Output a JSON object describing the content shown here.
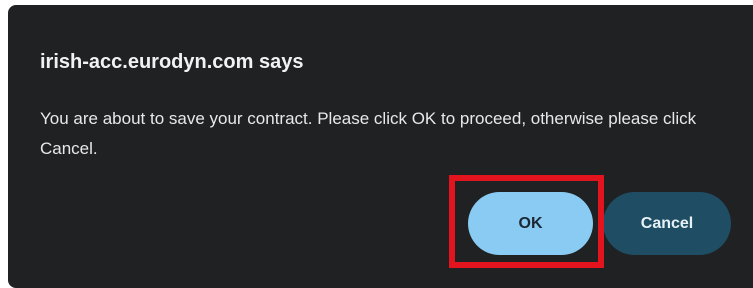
{
  "dialog": {
    "title": "irish-acc.eurodyn.com says",
    "message": "You are about to save your contract. Please click OK to proceed, otherwise please click Cancel.",
    "ok_label": "OK",
    "cancel_label": "Cancel"
  },
  "colors": {
    "dialog_background": "#1f2123",
    "ok_button": "#89cbf3",
    "cancel_button": "#1f4d63",
    "highlight_border": "#e3141e"
  }
}
